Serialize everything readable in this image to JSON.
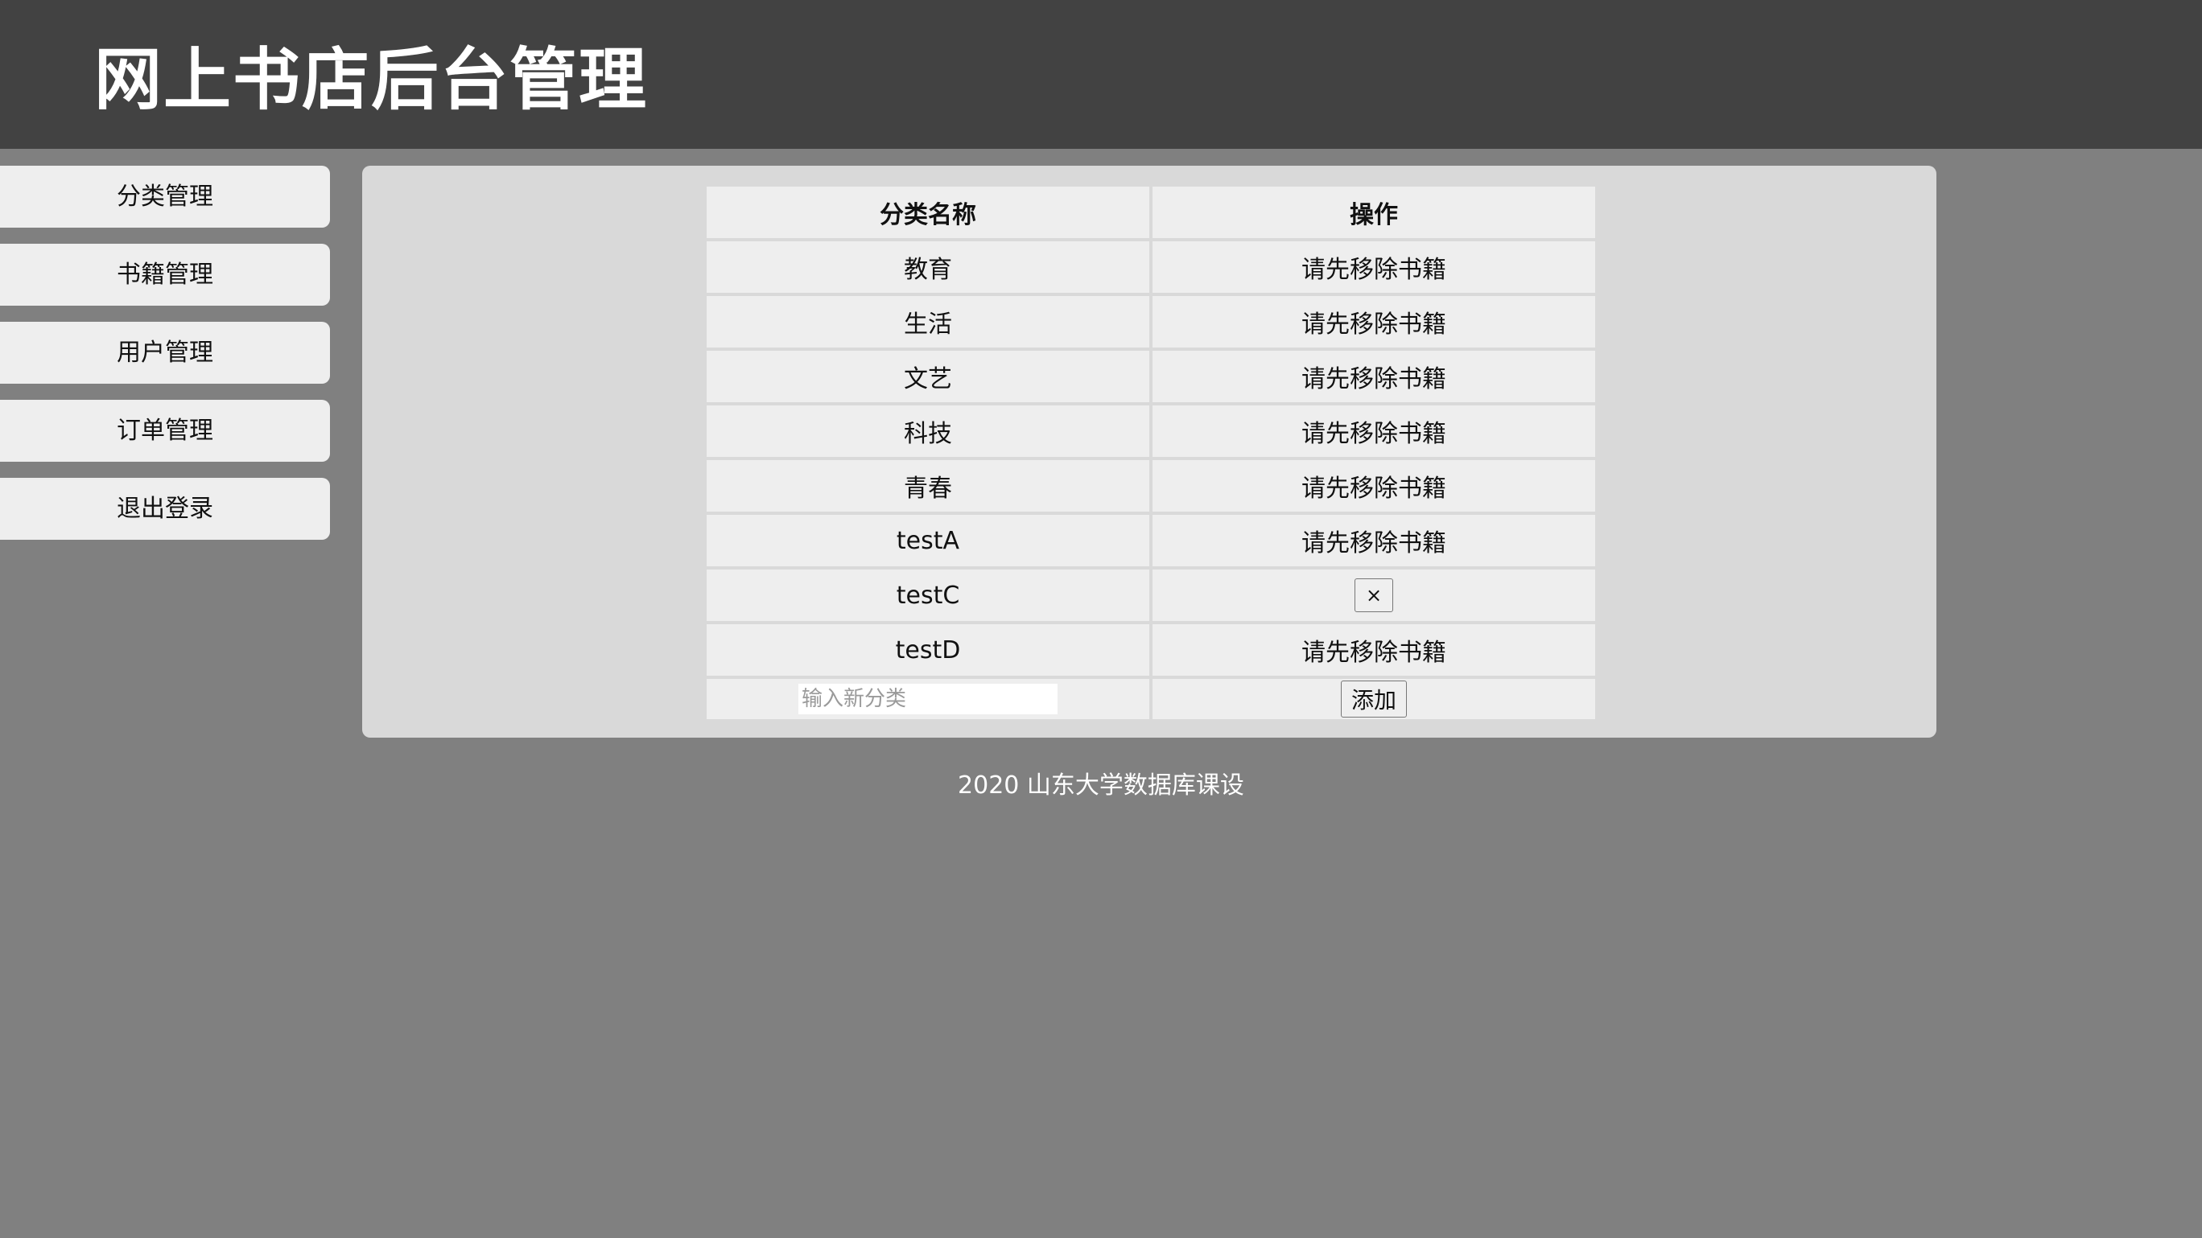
{
  "header": {
    "title": "网上书店后台管理"
  },
  "sidebar": {
    "items": [
      {
        "label": "分类管理"
      },
      {
        "label": "书籍管理"
      },
      {
        "label": "用户管理"
      },
      {
        "label": "订单管理"
      },
      {
        "label": "退出登录"
      }
    ]
  },
  "table": {
    "headers": {
      "name": "分类名称",
      "action": "操作"
    },
    "rows": [
      {
        "name": "教育",
        "action": "请先移除书籍"
      },
      {
        "name": "生活",
        "action": "请先移除书籍"
      },
      {
        "name": "文艺",
        "action": "请先移除书籍"
      },
      {
        "name": "科技",
        "action": "请先移除书籍"
      },
      {
        "name": "青春",
        "action": "请先移除书籍"
      },
      {
        "name": "testA",
        "action": "请先移除书籍"
      },
      {
        "name": "testC",
        "action": "×"
      },
      {
        "name": "testD",
        "action": "请先移除书籍"
      }
    ],
    "add_row": {
      "input_placeholder": "输入新分类",
      "input_value": "",
      "add_label": "添加"
    }
  },
  "footer": {
    "text": "2020 山东大学数据库课设"
  },
  "colors": {
    "header_bg": "#424242",
    "page_bg": "#808080",
    "panel_bg": "#d9d9d9",
    "cell_bg": "#eeeeee",
    "status_text": "#808080"
  }
}
